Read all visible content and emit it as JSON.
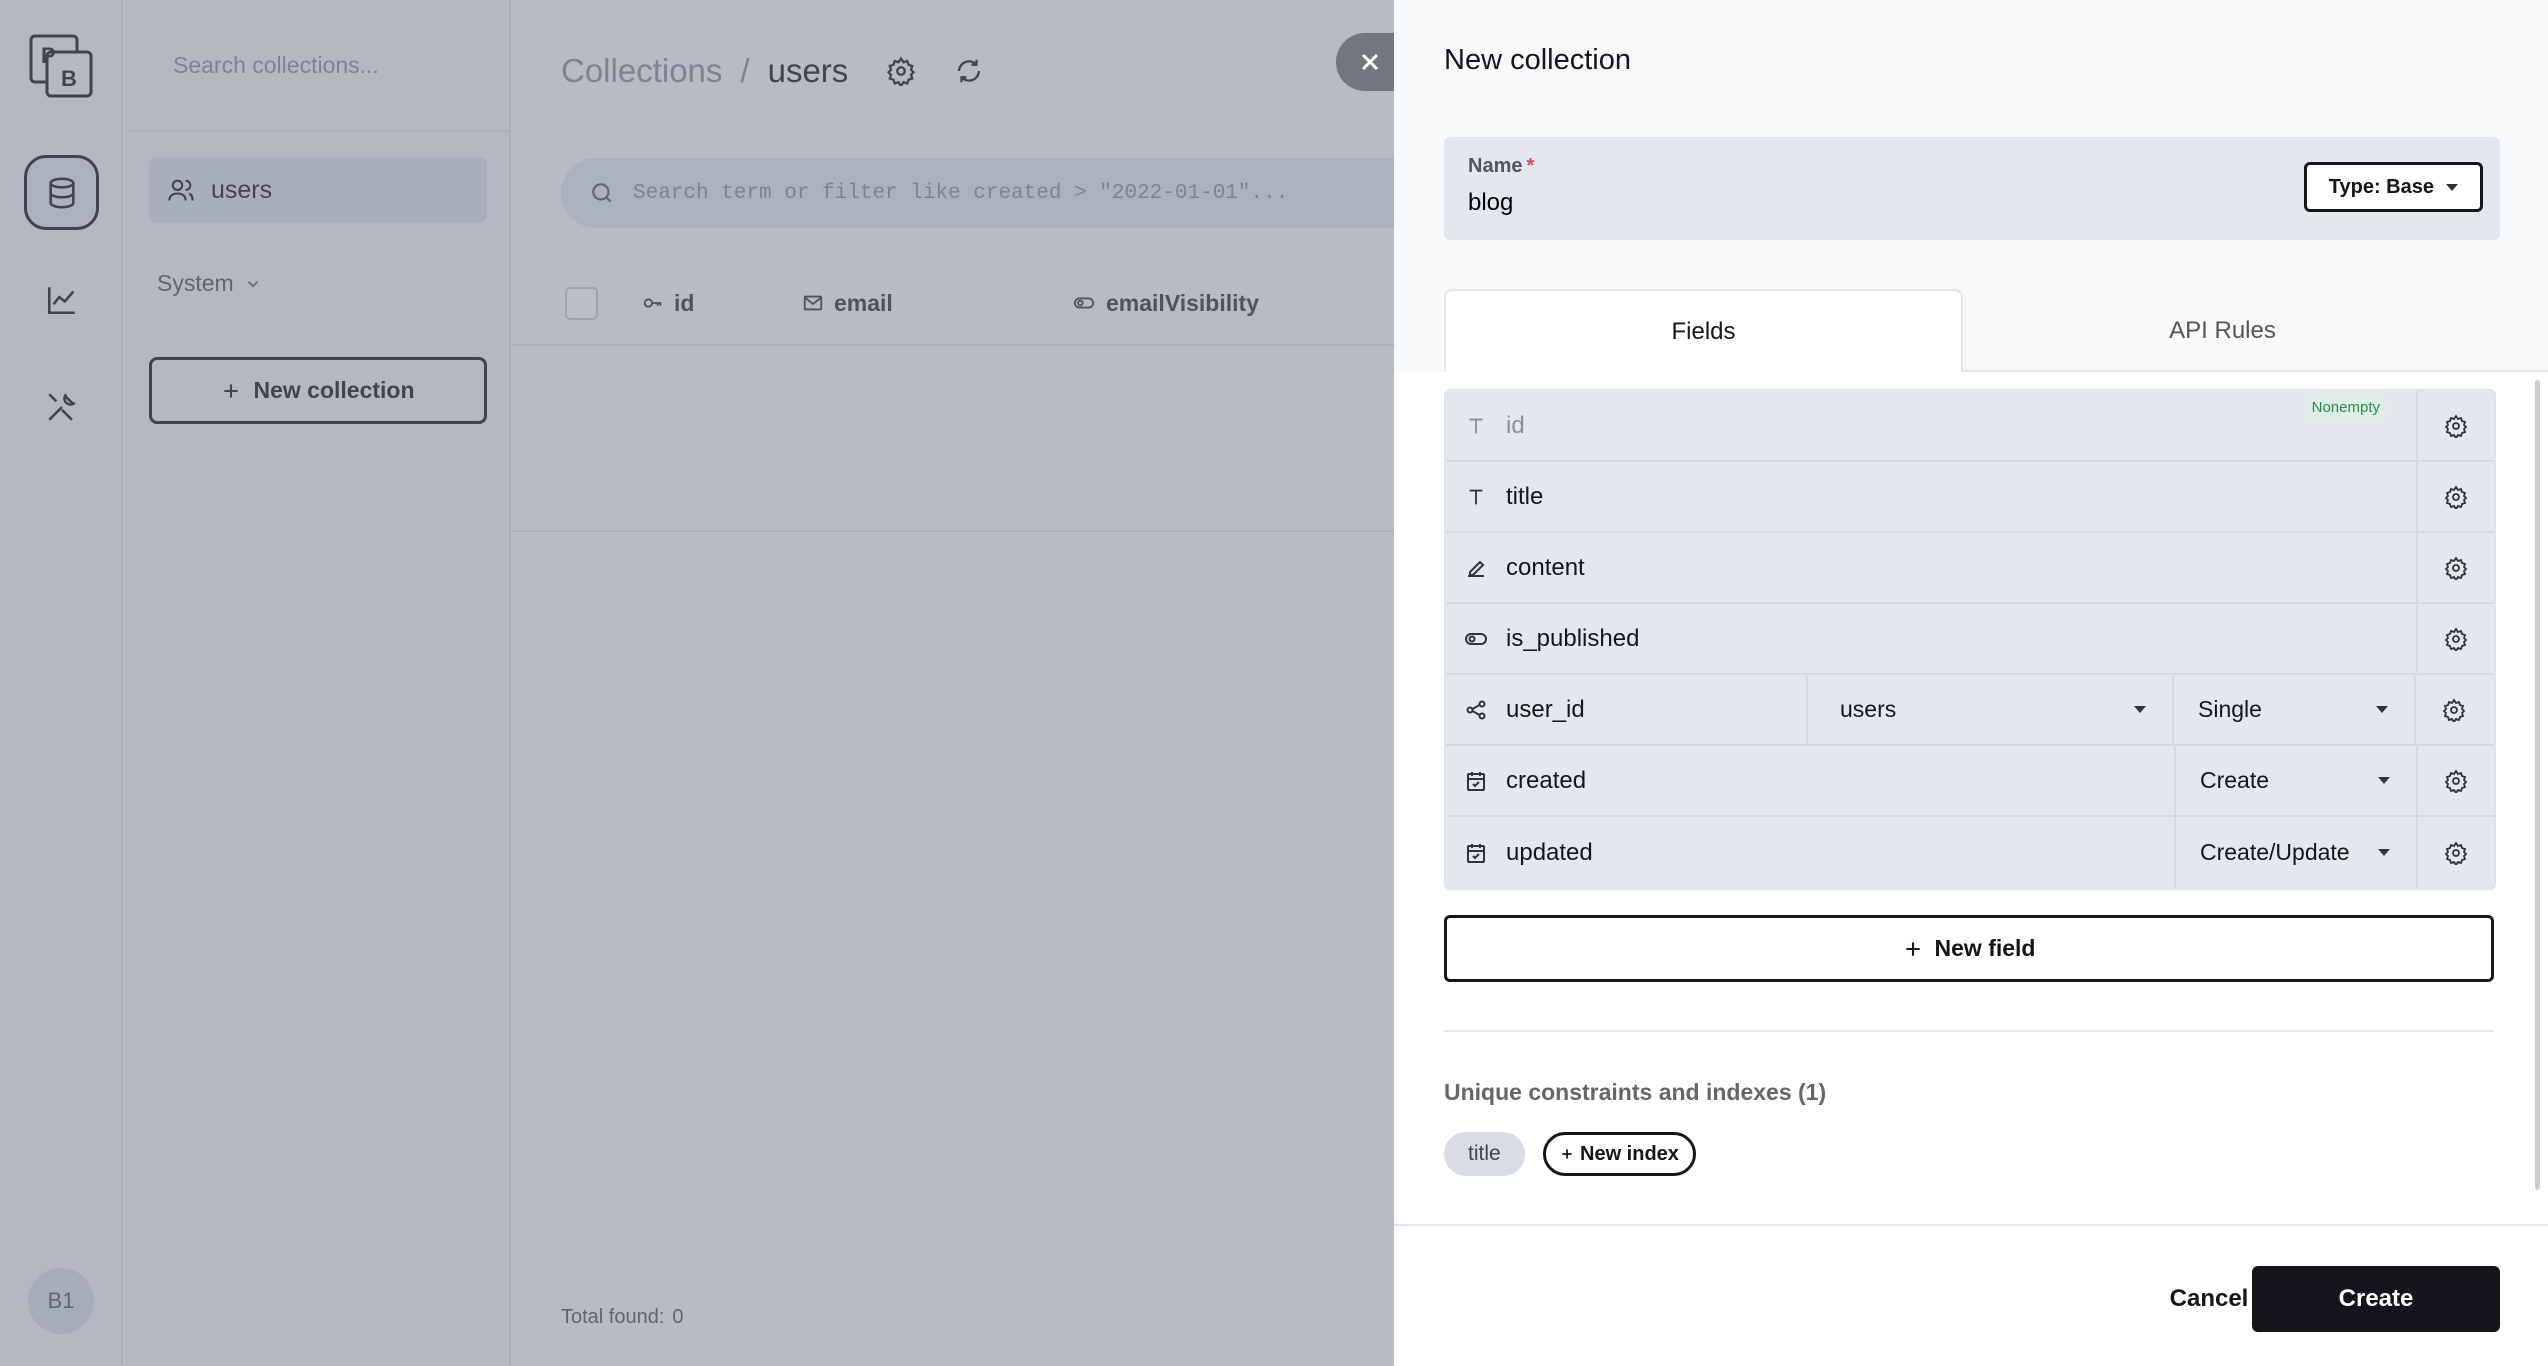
{
  "app": {
    "logo_text": "PB",
    "avatar_initials": "B1"
  },
  "rail": {
    "items": [
      "database-icon",
      "chart-line-icon",
      "tools-icon"
    ]
  },
  "sidebar": {
    "search_placeholder": "Search collections...",
    "items": [
      {
        "label": "users",
        "icon": "users-icon"
      }
    ],
    "system_label": "System",
    "new_collection_label": "New collection"
  },
  "main": {
    "breadcrumb": {
      "root": "Collections",
      "separator": "/",
      "current": "users"
    },
    "search_placeholder": "Search term or filter like created > \"2022-01-01\"...",
    "columns": [
      "id",
      "email",
      "emailVisibility"
    ],
    "total_label": "Total found:",
    "total_value": "0"
  },
  "panel": {
    "title": "New collection",
    "name_label": "Name",
    "required_mark": "*",
    "name_value": "blog",
    "type_label": "Type: Base",
    "tabs": [
      "Fields",
      "API Rules"
    ],
    "active_tab": "Fields",
    "fields": [
      {
        "name": "id",
        "icon": "text-icon",
        "badge": "Nonempty"
      },
      {
        "name": "title",
        "icon": "text-icon"
      },
      {
        "name": "content",
        "icon": "editor-icon"
      },
      {
        "name": "is_published",
        "icon": "toggle-icon"
      },
      {
        "name": "user_id",
        "icon": "relation-icon",
        "collection": "users",
        "mode": "Single"
      },
      {
        "name": "created",
        "icon": "calendar-icon",
        "mode": "Create"
      },
      {
        "name": "updated",
        "icon": "calendar-icon",
        "mode": "Create/Update"
      }
    ],
    "new_field_label": "New field",
    "indexes_title": "Unique constraints and indexes (1)",
    "index_chips": [
      "title"
    ],
    "new_index_label": "New index",
    "cancel_label": "Cancel",
    "create_label": "Create"
  },
  "colors": {
    "primary": "#16161a",
    "overlay": "#6e788a",
    "required": "#e34562",
    "success": "#2d8a4e"
  }
}
